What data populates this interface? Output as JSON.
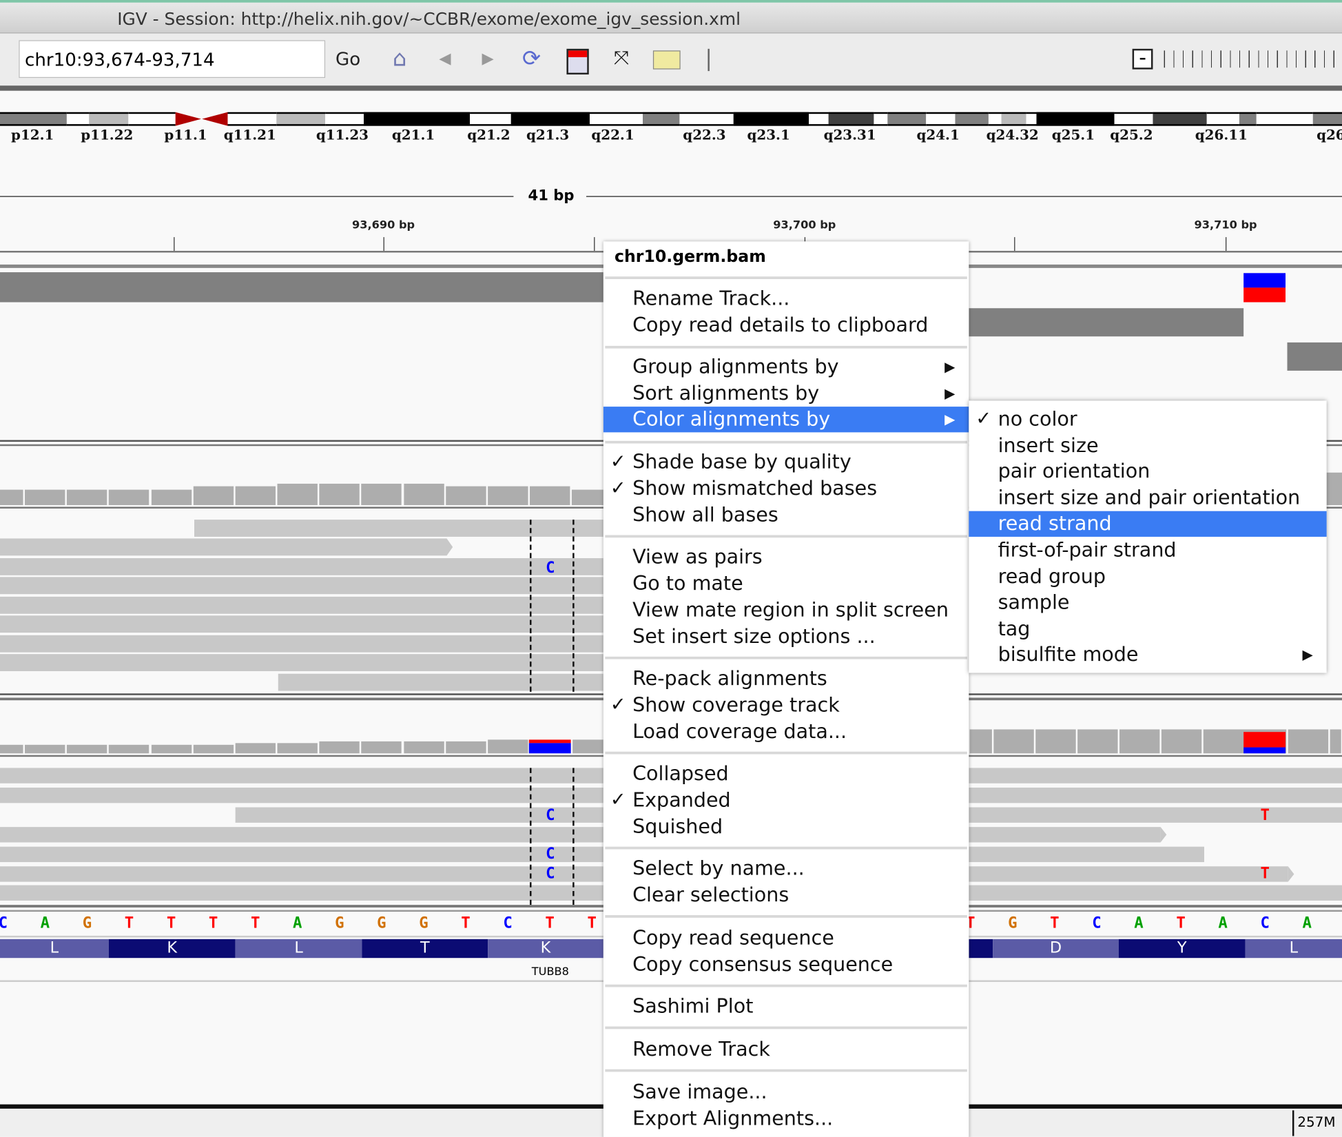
{
  "window": {
    "title": "IGV - Session: http://helix.nih.gov/~CCBR/exome/exome_igv_session.xml"
  },
  "toolbar": {
    "locus": "chr10:93,674-93,714",
    "go_label": "Go",
    "icons": [
      "home-icon",
      "back-icon",
      "forward-icon",
      "refresh-icon",
      "region-of-interest-icon",
      "fit-to-window-icon",
      "popup-info-icon"
    ]
  },
  "ideogram": {
    "bands": [
      "p12.1",
      "p11.22",
      "p11.1",
      "q11.21",
      "q11.23",
      "q21.1",
      "q21.2",
      "q21.3",
      "q22.1",
      "q22.3",
      "q23.1",
      "q23.31",
      "q24.1",
      "q24.32",
      "q25.1",
      "q25.2",
      "q26.11",
      "q26"
    ]
  },
  "ruler": {
    "span": "41 bp",
    "ticks": [
      "93,690 bp",
      "93,700 bp",
      "93,710 bp"
    ]
  },
  "reads": {
    "mismatch_C": "C",
    "mismatch_T": "T"
  },
  "sequence": {
    "left": [
      "C",
      "A",
      "G",
      "T",
      "T",
      "T",
      "T",
      "A",
      "G",
      "G",
      "G",
      "T",
      "C",
      "T",
      "T"
    ],
    "right": [
      "T",
      "G",
      "T",
      "C",
      "A",
      "T",
      "A",
      "C",
      "A"
    ],
    "colors": {
      "A": "#00a000",
      "C": "#0000ff",
      "G": "#d17105",
      "T": "#ff0000"
    }
  },
  "translation": {
    "left": [
      "L",
      "K",
      "L",
      "T",
      "K"
    ],
    "right": [
      "D",
      "Y",
      "L"
    ]
  },
  "gene": {
    "name": "TUBB8"
  },
  "context_menu": {
    "header": "chr10.germ.bam",
    "items": [
      {
        "label": "Rename Track..."
      },
      {
        "label": "Copy read details to clipboard"
      },
      {
        "label": "Group alignments by",
        "submenu": true
      },
      {
        "label": "Sort alignments by",
        "submenu": true
      },
      {
        "label": "Color alignments by",
        "submenu": true,
        "highlighted": true
      },
      {
        "label": "Shade base by quality",
        "checked": true
      },
      {
        "label": "Show mismatched bases",
        "checked": true
      },
      {
        "label": "Show all bases"
      },
      {
        "label": "View as pairs"
      },
      {
        "label": "Go to mate"
      },
      {
        "label": "View mate region in split screen"
      },
      {
        "label": "Set insert size options ..."
      },
      {
        "label": "Re-pack alignments"
      },
      {
        "label": "Show coverage track",
        "checked": true
      },
      {
        "label": "Load coverage data..."
      },
      {
        "label": "Collapsed"
      },
      {
        "label": "Expanded",
        "checked": true
      },
      {
        "label": "Squished"
      },
      {
        "label": "Select by name..."
      },
      {
        "label": "Clear selections"
      },
      {
        "label": "Copy read sequence"
      },
      {
        "label": "Copy consensus sequence"
      },
      {
        "label": "Sashimi Plot"
      },
      {
        "label": "Remove Track"
      },
      {
        "label": "Save image..."
      },
      {
        "label": "Export Alignments..."
      }
    ]
  },
  "color_submenu": {
    "items": [
      {
        "label": "no color",
        "checked": true
      },
      {
        "label": "insert size"
      },
      {
        "label": "pair orientation"
      },
      {
        "label": "insert size and pair orientation"
      },
      {
        "label": "read strand",
        "highlighted": true
      },
      {
        "label": "first-of-pair strand"
      },
      {
        "label": "read group"
      },
      {
        "label": "sample"
      },
      {
        "label": "tag"
      },
      {
        "label": "bisulfite mode",
        "submenu": true
      }
    ]
  },
  "status": {
    "memory": "257M"
  },
  "colors": {
    "highlight": "#3a7cf3",
    "read": "#c8c8c8",
    "coverage": "#adadad",
    "translation_light": "#5b5ba6",
    "translation_dark": "#0b0b73"
  }
}
